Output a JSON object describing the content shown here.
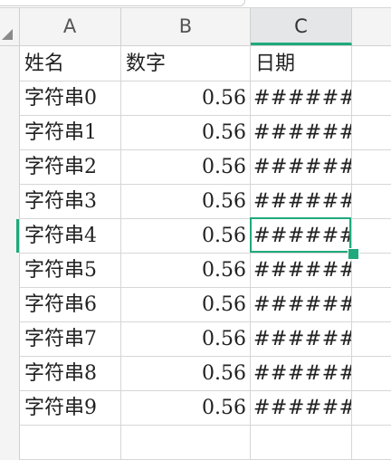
{
  "columns": [
    {
      "letter": "A",
      "selected": false
    },
    {
      "letter": "B",
      "selected": false
    },
    {
      "letter": "C",
      "selected": true
    }
  ],
  "header_row": {
    "name": "姓名",
    "number": "数字",
    "date": "日期"
  },
  "rows": [
    {
      "name": "字符串0",
      "number": "0.56",
      "date": "######"
    },
    {
      "name": "字符串1",
      "number": "0.56",
      "date": "######"
    },
    {
      "name": "字符串2",
      "number": "0.56",
      "date": "######"
    },
    {
      "name": "字符串3",
      "number": "0.56",
      "date": "######"
    },
    {
      "name": "字符串4",
      "number": "0.56",
      "date": "######"
    },
    {
      "name": "字符串5",
      "number": "0.56",
      "date": "######"
    },
    {
      "name": "字符串6",
      "number": "0.56",
      "date": "######"
    },
    {
      "name": "字符串7",
      "number": "0.56",
      "date": "######"
    },
    {
      "name": "字符串8",
      "number": "0.56",
      "date": "######"
    },
    {
      "name": "字符串9",
      "number": "0.56",
      "date": "######"
    }
  ],
  "active_cell": "C6",
  "colors": {
    "accent": "#1fa97c",
    "header_bg": "#f4f4f4",
    "selected_header_bg": "#e4e6e8",
    "grid": "#d6d6d6"
  }
}
